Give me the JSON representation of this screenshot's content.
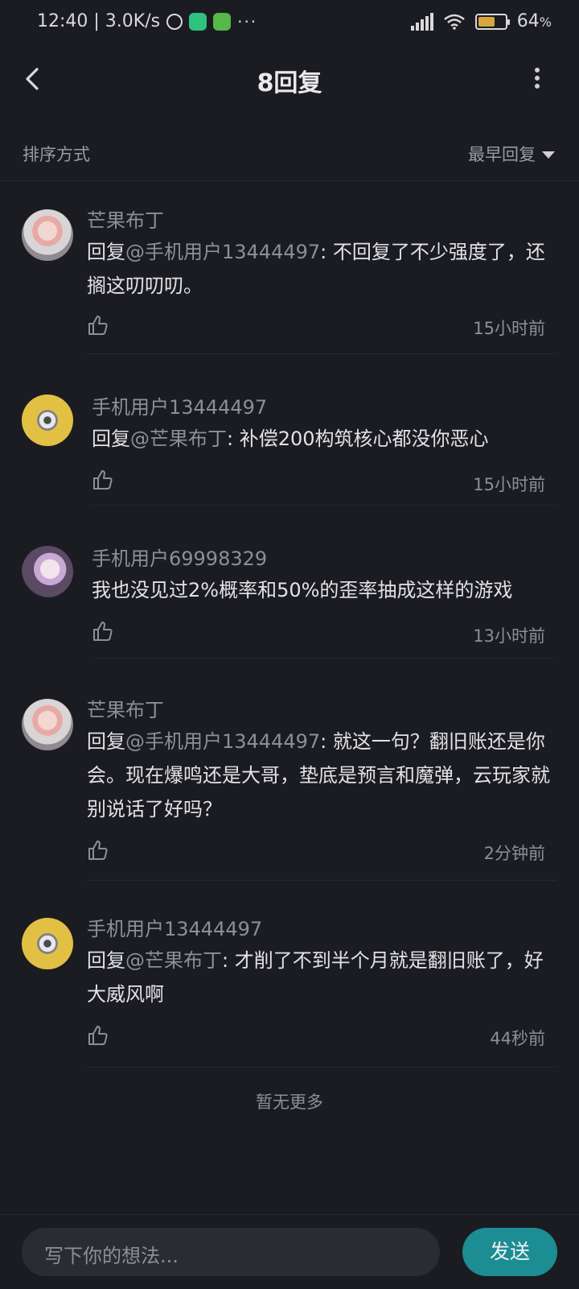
{
  "status_bar": {
    "time_speed": "12:40 | 3.0K/s",
    "more_indicator": "···",
    "battery_percent": "64",
    "battery_unit": "%",
    "battery_level": 0.64
  },
  "header": {
    "title": "8回复"
  },
  "sort": {
    "label": "排序方式",
    "value": "最早回复"
  },
  "replies": [
    {
      "username": "芒果布丁",
      "reply_prefix": "回复",
      "reply_target": "@手机用户13444497",
      "text": ": 不回复了不少强度了，还搁这叨叨叨。",
      "time": "15小时前",
      "avatar": "avatar-girl-pink"
    },
    {
      "username": "手机用户13444497",
      "reply_prefix": "回复",
      "reply_target": "@芒果布丁",
      "text": ": 补偿200构筑核心都没你恶心",
      "time": "15小时前",
      "avatar": "avatar-minion"
    },
    {
      "username": "手机用户69998329",
      "reply_prefix": "",
      "reply_target": "",
      "text": "我也没见过2%概率和50%的歪率抽成这样的游戏",
      "time": "13小时前",
      "avatar": "avatar-girl-anime"
    },
    {
      "username": "芒果布丁",
      "reply_prefix": "回复",
      "reply_target": "@手机用户13444497",
      "text": ": 就这一句？翻旧账还是你会。现在爆鸣还是大哥，垫底是预言和魔弹，云玩家就别说话了好吗？",
      "time": "2分钟前",
      "avatar": "avatar-girl-pink"
    },
    {
      "username": "手机用户13444497",
      "reply_prefix": "回复",
      "reply_target": "@芒果布丁",
      "text": ": 才削了不到半个月就是翻旧账了，好大威风啊",
      "time": "44秒前",
      "avatar": "avatar-minion"
    }
  ],
  "footer": {
    "no_more": "暂无更多"
  },
  "composer": {
    "placeholder": "写下你的想法...",
    "send_label": "发送"
  },
  "colors": {
    "background": "#1b1c22",
    "send_button": "#1b8d93",
    "battery_fill": "#d8a63a"
  }
}
